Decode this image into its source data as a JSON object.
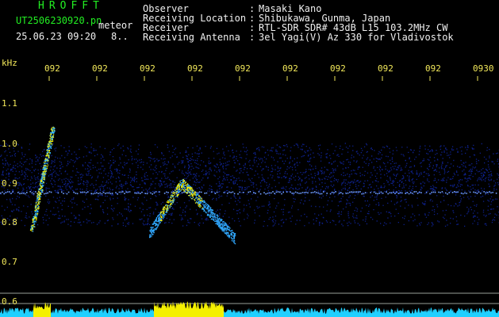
{
  "app_title": "HROFFT",
  "file": {
    "name": "UT2506230920.pn",
    "suffix": "meteor",
    "datetime": "25.06.23 09:20",
    "extra": "8.."
  },
  "header": {
    "rows": [
      {
        "label": "Observer",
        "sep": ":",
        "value": "Masaki Kano"
      },
      {
        "label": "Receiving Location",
        "sep": ":",
        "value": "Shibukawa, Gunma, Japan"
      },
      {
        "label": "Receiver",
        "sep": ":",
        "value": "RTL-SDR SDR# 43dB L15 103.2MHz CW"
      },
      {
        "label": "Receiving Antenna",
        "sep": ":",
        "value": "3el Yagi(V) Az 330 for Vladivostok"
      }
    ]
  },
  "spectrogram": {
    "y_unit": "kHz",
    "y_ticks": [
      "1.1",
      "1.0",
      "0.9",
      "0.8",
      "0.7",
      "0.6"
    ],
    "x_ticks": [
      "092",
      "092",
      "092",
      "092",
      "092",
      "092",
      "092",
      "092",
      "092",
      "0930"
    ],
    "colors": {
      "background": "#000000",
      "noise": "#1a3cff",
      "signal": "#f4f000",
      "floor": "#20d0ff",
      "text": "#f2e85a"
    }
  }
}
